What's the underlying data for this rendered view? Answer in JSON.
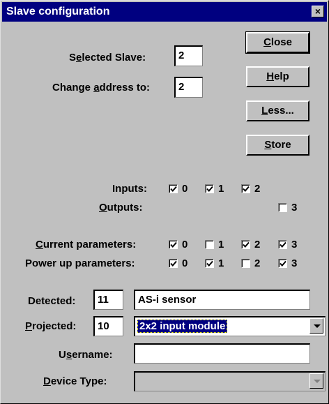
{
  "window": {
    "title": "Slave configuration",
    "close_glyph": "×"
  },
  "selected_slave": {
    "pre": "S",
    "u": "e",
    "post": "lected Slave:",
    "value": "2"
  },
  "change_address": {
    "pre": "Change ",
    "u": "a",
    "post": "ddress to:",
    "value": "2"
  },
  "buttons": {
    "close": {
      "u": "C",
      "rest": "lose"
    },
    "help": {
      "u": "H",
      "rest": "elp"
    },
    "less": {
      "u": "L",
      "rest": "ess..."
    },
    "store": {
      "u": "S",
      "rest": "tore"
    }
  },
  "io": {
    "inputs_label": "Inputs:",
    "outputs_label": {
      "u": "O",
      "rest": "utputs:"
    },
    "inputs": [
      {
        "n": "0",
        "checked": true
      },
      {
        "n": "1",
        "checked": true
      },
      {
        "n": "2",
        "checked": true
      }
    ],
    "outputs": [
      {
        "n": "3",
        "checked": false
      }
    ]
  },
  "params": {
    "current_label": {
      "u": "C",
      "rest": "urrent parameters:"
    },
    "powerup_label": "Power up parameters:",
    "current": [
      {
        "n": "0",
        "checked": true
      },
      {
        "n": "1",
        "checked": false
      },
      {
        "n": "2",
        "checked": true
      },
      {
        "n": "3",
        "checked": true
      }
    ],
    "powerup": [
      {
        "n": "0",
        "checked": true
      },
      {
        "n": "1",
        "checked": true
      },
      {
        "n": "2",
        "checked": false
      },
      {
        "n": "3",
        "checked": true
      }
    ]
  },
  "detected": {
    "label": "Detected:",
    "code": "11",
    "name": "AS-i sensor"
  },
  "projected": {
    "label": {
      "u": "P",
      "rest": "rojected:"
    },
    "code": "10",
    "selected": "2x2 input module"
  },
  "username": {
    "label": {
      "pre": "U",
      "u": "s",
      "rest": "ername:"
    },
    "value": ""
  },
  "device_type": {
    "label": {
      "u": "D",
      "rest": "evice Type:"
    },
    "value": ""
  },
  "icons": {
    "check": "checkmark-icon",
    "dropdown": "chevron-down-icon"
  }
}
